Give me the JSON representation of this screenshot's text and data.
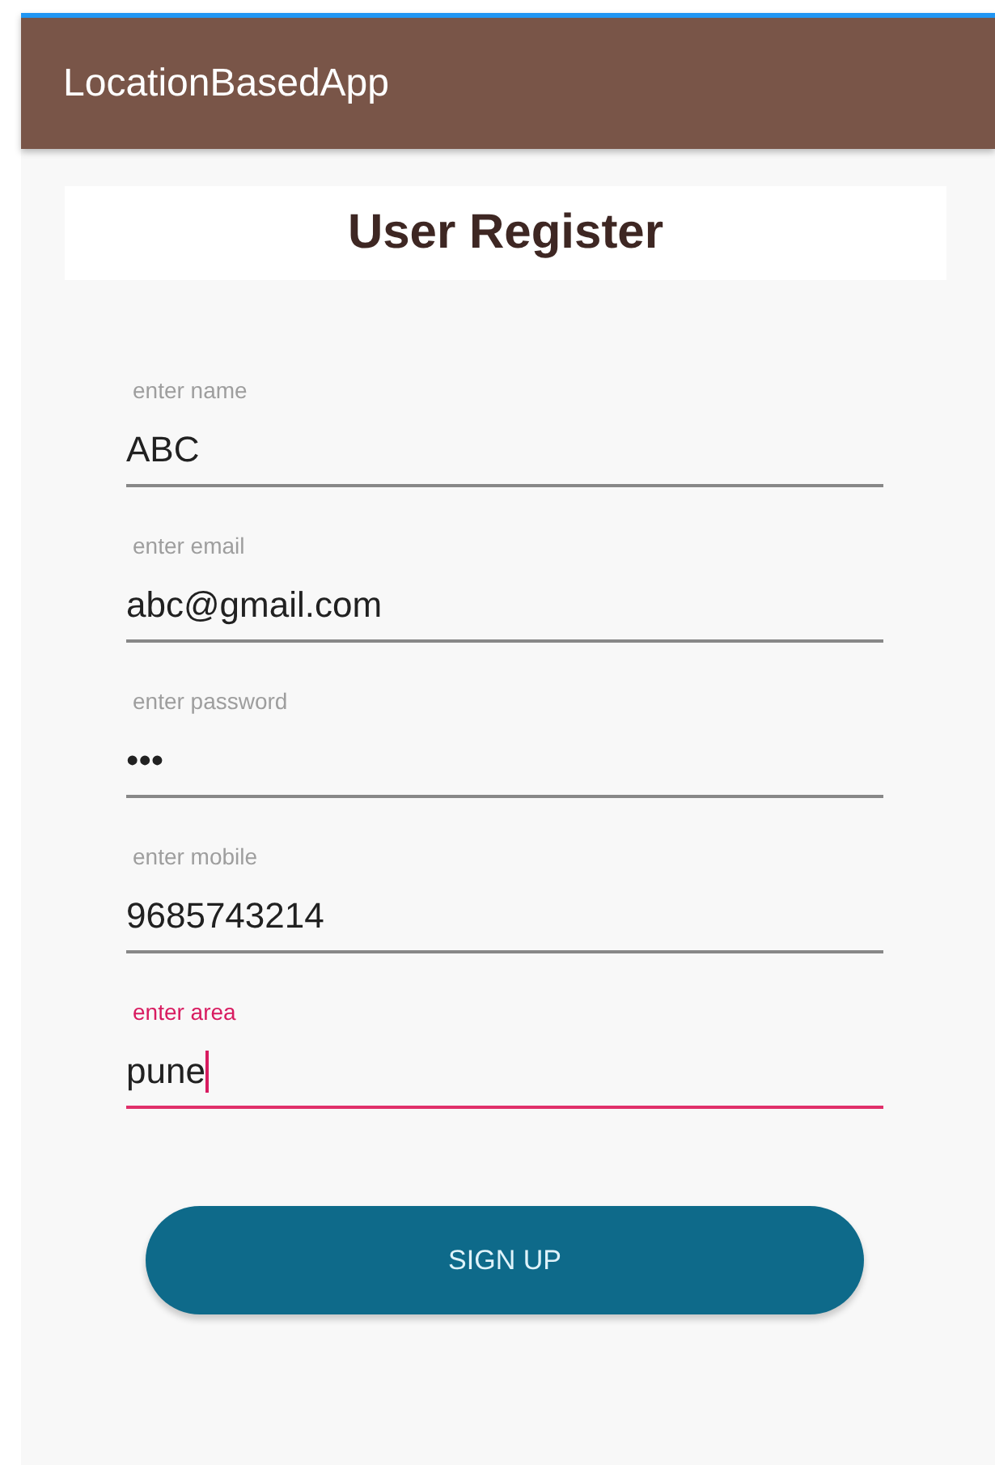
{
  "app_bar": {
    "title": "LocationBasedApp"
  },
  "heading": "User Register",
  "fields": [
    {
      "label": "enter name",
      "value": "ABC",
      "focused": false
    },
    {
      "label": "enter email",
      "value": "abc@gmail.com",
      "focused": false
    },
    {
      "label": "enter password",
      "value": "•••",
      "focused": false
    },
    {
      "label": "enter mobile",
      "value": "9685743214",
      "focused": false
    },
    {
      "label": "enter area",
      "value": "pune",
      "focused": true
    }
  ],
  "button": "SIGN UP"
}
